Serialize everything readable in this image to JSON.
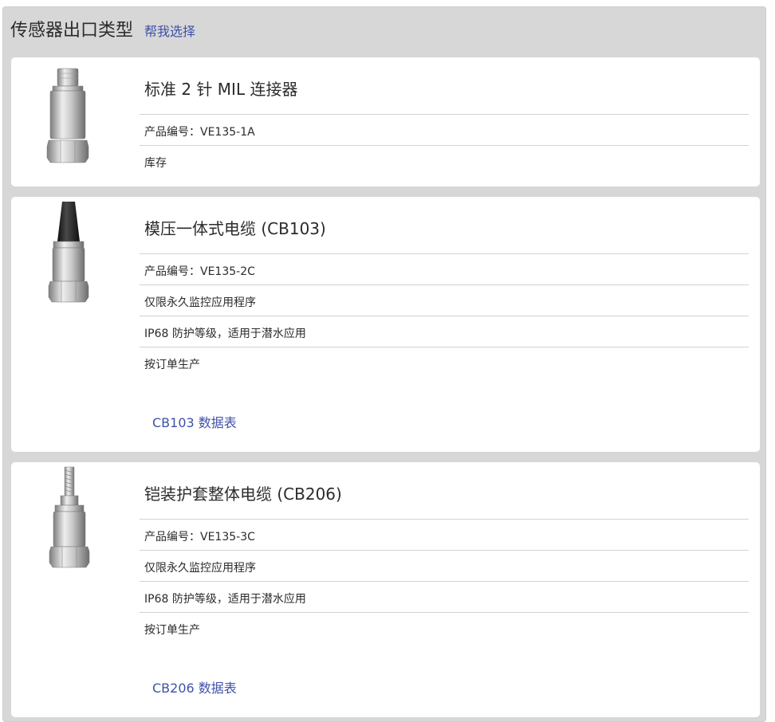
{
  "header": {
    "title": "传感器出口类型",
    "help_link": "帮我选择"
  },
  "products": [
    {
      "name": "标准 2 针 MIL 连接器",
      "part_number": "产品编号：VE135-1A",
      "rows": [
        "库存"
      ],
      "image_icon": "mil-connector-sensor-icon"
    },
    {
      "name": "模压一体式电缆 (CB103)",
      "part_number": "产品编号：VE135-2C",
      "rows": [
        "仅限永久监控应用程序",
        "IP68 防护等级，适用于潜水应用",
        "按订单生产"
      ],
      "datasheet": "CB103 数据表",
      "image_icon": "molded-cable-sensor-icon"
    },
    {
      "name": "铠装护套整体电缆 (CB206)",
      "part_number": "产品编号：VE135-3C",
      "rows": [
        "仅限永久监控应用程序",
        "IP68 防护等级，适用于潜水应用",
        "按订单生产"
      ],
      "datasheet": "CB206 数据表",
      "image_icon": "armored-cable-sensor-icon"
    }
  ]
}
